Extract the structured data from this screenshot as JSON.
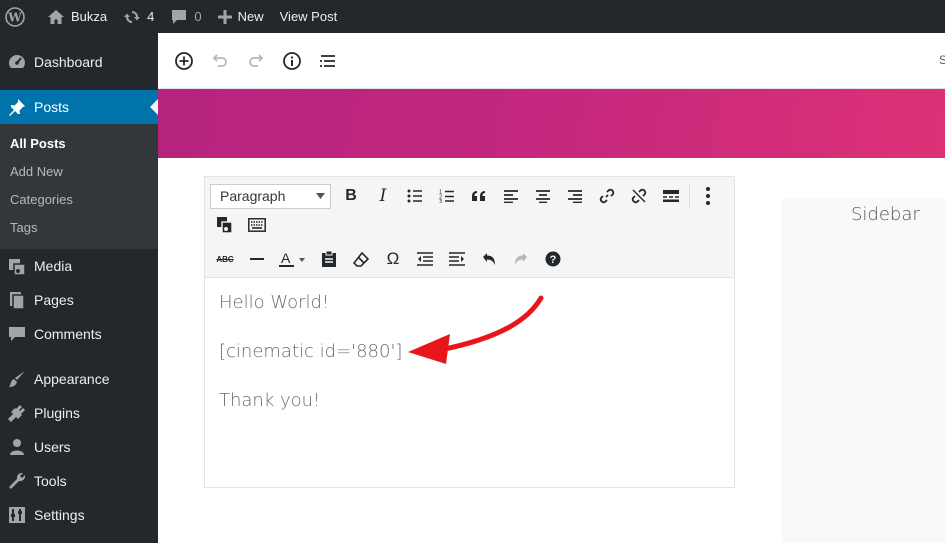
{
  "adminbar": {
    "site_name": "Bukza",
    "updates_count": "4",
    "comments_count": "0",
    "new_label": "New",
    "view_post_label": "View Post"
  },
  "sidebar": {
    "items": [
      {
        "label": "Dashboard",
        "icon": "dashboard-icon"
      },
      {
        "label": "Posts",
        "icon": "pin-icon"
      },
      {
        "label": "Media",
        "icon": "media-icon"
      },
      {
        "label": "Pages",
        "icon": "pages-icon"
      },
      {
        "label": "Comments",
        "icon": "comments-icon"
      },
      {
        "label": "Appearance",
        "icon": "brush-icon"
      },
      {
        "label": "Plugins",
        "icon": "plug-icon"
      },
      {
        "label": "Users",
        "icon": "users-icon"
      },
      {
        "label": "Tools",
        "icon": "wrench-icon"
      },
      {
        "label": "Settings",
        "icon": "settings-icon"
      }
    ],
    "posts_submenu": [
      "All Posts",
      "Add New",
      "Categories",
      "Tags"
    ]
  },
  "editor": {
    "header_right_letter": "S",
    "format_select_value": "Paragraph",
    "content": {
      "line1": "Hello World!",
      "line2": "[cinematic id='880']",
      "line3": "Thank you!"
    }
  },
  "widget_sidebar": {
    "title": "Sidebar"
  },
  "colors": {
    "admin_bg": "#23282d",
    "menu_active": "#0073aa",
    "gradient_start": "#b5237f",
    "gradient_end": "#dc3176",
    "arrow": "#e8161b"
  }
}
